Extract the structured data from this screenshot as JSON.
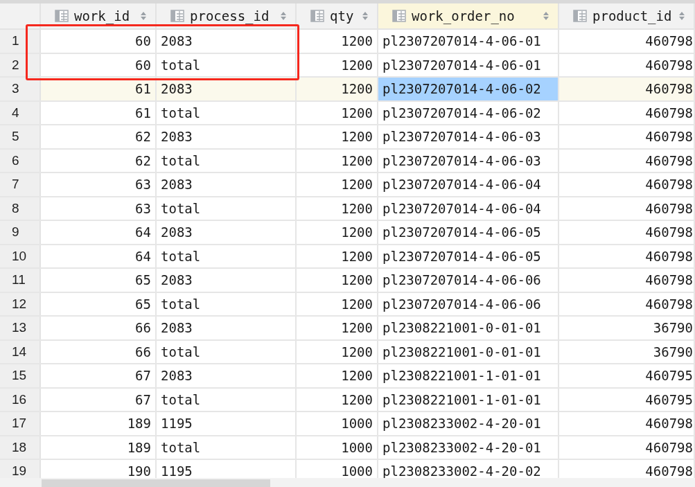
{
  "table": {
    "columns": [
      {
        "name": "work_id",
        "kind": "number",
        "selected": false
      },
      {
        "name": "process_id",
        "kind": "text",
        "selected": false
      },
      {
        "name": "qty",
        "kind": "number",
        "selected": false
      },
      {
        "name": "work_order_no",
        "kind": "text",
        "selected": true
      },
      {
        "name": "product_id",
        "kind": "number",
        "selected": false
      }
    ],
    "rows": [
      {
        "number": "1",
        "current": false,
        "cells": [
          "60",
          "2083",
          "1200",
          "pl2307207014-4-06-01",
          "460798"
        ]
      },
      {
        "number": "2",
        "current": false,
        "cells": [
          "60",
          "total",
          "1200",
          "pl2307207014-4-06-01",
          "460798"
        ]
      },
      {
        "number": "3",
        "current": true,
        "cells": [
          "61",
          "2083",
          "1200",
          "pl2307207014-4-06-02",
          "460798"
        ]
      },
      {
        "number": "4",
        "current": false,
        "cells": [
          "61",
          "total",
          "1200",
          "pl2307207014-4-06-02",
          "460798"
        ]
      },
      {
        "number": "5",
        "current": false,
        "cells": [
          "62",
          "2083",
          "1200",
          "pl2307207014-4-06-03",
          "460798"
        ]
      },
      {
        "number": "6",
        "current": false,
        "cells": [
          "62",
          "total",
          "1200",
          "pl2307207014-4-06-03",
          "460798"
        ]
      },
      {
        "number": "7",
        "current": false,
        "cells": [
          "63",
          "2083",
          "1200",
          "pl2307207014-4-06-04",
          "460798"
        ]
      },
      {
        "number": "8",
        "current": false,
        "cells": [
          "63",
          "total",
          "1200",
          "pl2307207014-4-06-04",
          "460798"
        ]
      },
      {
        "number": "9",
        "current": false,
        "cells": [
          "64",
          "2083",
          "1200",
          "pl2307207014-4-06-05",
          "460798"
        ]
      },
      {
        "number": "10",
        "current": false,
        "cells": [
          "64",
          "total",
          "1200",
          "pl2307207014-4-06-05",
          "460798"
        ]
      },
      {
        "number": "11",
        "current": false,
        "cells": [
          "65",
          "2083",
          "1200",
          "pl2307207014-4-06-06",
          "460798"
        ]
      },
      {
        "number": "12",
        "current": false,
        "cells": [
          "65",
          "total",
          "1200",
          "pl2307207014-4-06-06",
          "460798"
        ]
      },
      {
        "number": "13",
        "current": false,
        "cells": [
          "66",
          "2083",
          "1200",
          "pl2308221001-0-01-01",
          "36790"
        ]
      },
      {
        "number": "14",
        "current": false,
        "cells": [
          "66",
          "total",
          "1200",
          "pl2308221001-0-01-01",
          "36790"
        ]
      },
      {
        "number": "15",
        "current": false,
        "cells": [
          "67",
          "2083",
          "1200",
          "pl2308221001-1-01-01",
          "460795"
        ]
      },
      {
        "number": "16",
        "current": false,
        "cells": [
          "67",
          "total",
          "1200",
          "pl2308221001-1-01-01",
          "460795"
        ]
      },
      {
        "number": "17",
        "current": false,
        "cells": [
          "189",
          "1195",
          "1000",
          "pl2308233002-4-20-01",
          "460798"
        ]
      },
      {
        "number": "18",
        "current": false,
        "cells": [
          "189",
          "total",
          "1000",
          "pl2308233002-4-20-01",
          "460798"
        ]
      },
      {
        "number": "19",
        "current": false,
        "cells": [
          "190",
          "1195",
          "1000",
          "pl2308233002-4-20-02",
          "460798"
        ]
      }
    ]
  },
  "annotation": {
    "kind": "rectangle",
    "color": "#f5281e"
  }
}
